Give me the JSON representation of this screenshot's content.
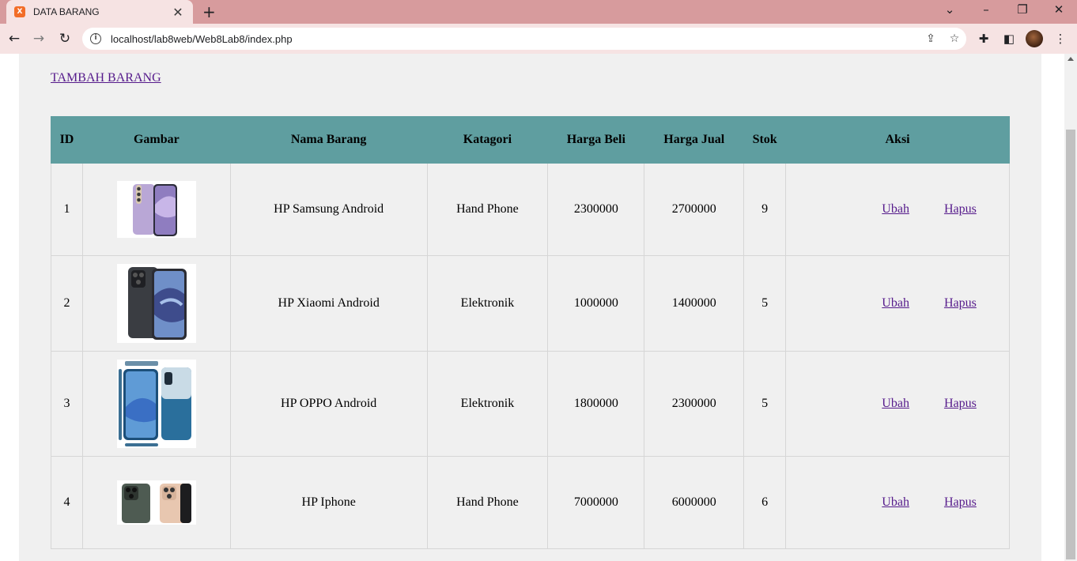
{
  "browser": {
    "tab_title": "DATA BARANG",
    "tab_close": "✕",
    "new_tab": "+",
    "url": "localhost/lab8web/Web8Lab8/index.php"
  },
  "icons": {
    "favicon": "xampp-icon",
    "back": "back-arrow-icon",
    "forward": "forward-arrow-icon",
    "reload": "reload-icon",
    "info": "info-icon",
    "share": "share-icon",
    "bookmark": "star-icon",
    "extensions": "puzzle-icon",
    "sidepanel": "side-panel-icon",
    "menu": "kebab-menu-icon"
  },
  "page": {
    "add_link": "TAMBAH BARANG",
    "header_color": "#5f9ea0",
    "link_color": "#551a8b"
  },
  "table": {
    "headers": [
      "ID",
      "Gambar",
      "Nama Barang",
      "Katagori",
      "Harga Beli",
      "Harga Jual",
      "Stok",
      "Aksi"
    ],
    "rows": [
      {
        "id": "1",
        "nama": "HP Samsung Android",
        "kategori": "Hand Phone",
        "harga_beli": "2300000",
        "harga_jual": "2700000",
        "stok": "9",
        "ubah": "Ubah",
        "hapus": "Hapus"
      },
      {
        "id": "2",
        "nama": "HP Xiaomi Android",
        "kategori": "Elektronik",
        "harga_beli": "1000000",
        "harga_jual": "1400000",
        "stok": "5",
        "ubah": "Ubah",
        "hapus": "Hapus"
      },
      {
        "id": "3",
        "nama": "HP OPPO Android",
        "kategori": "Elektronik",
        "harga_beli": "1800000",
        "harga_jual": "2300000",
        "stok": "5",
        "ubah": "Ubah",
        "hapus": "Hapus"
      },
      {
        "id": "4",
        "nama": "HP Iphone",
        "kategori": "Hand Phone",
        "harga_beli": "7000000",
        "harga_jual": "6000000",
        "stok": "6",
        "ubah": "Ubah",
        "hapus": "Hapus"
      }
    ]
  }
}
